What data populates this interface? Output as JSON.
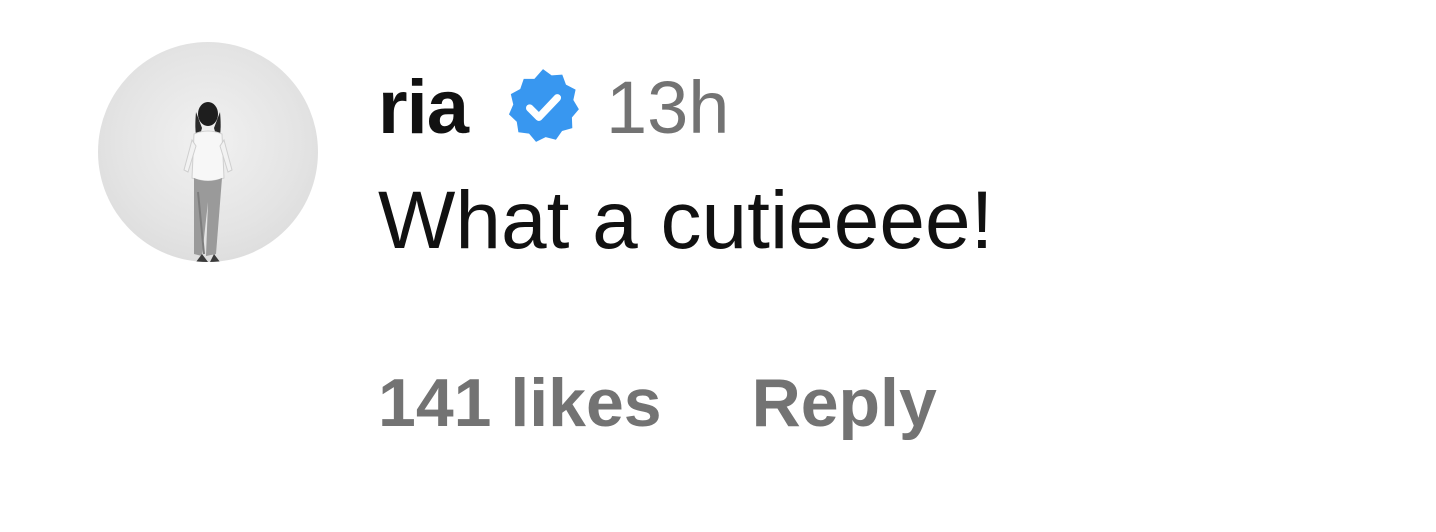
{
  "comment": {
    "username": "ria",
    "verified": true,
    "timestamp": "13h",
    "text": "What a cutieeee!",
    "likes_label": "141 likes",
    "reply_label": "Reply"
  },
  "icons": {
    "verified": "verified-badge-icon",
    "avatar": "profile-avatar"
  },
  "colors": {
    "verified_blue": "#3897f0",
    "text_primary": "#111111",
    "text_secondary": "#737373"
  }
}
